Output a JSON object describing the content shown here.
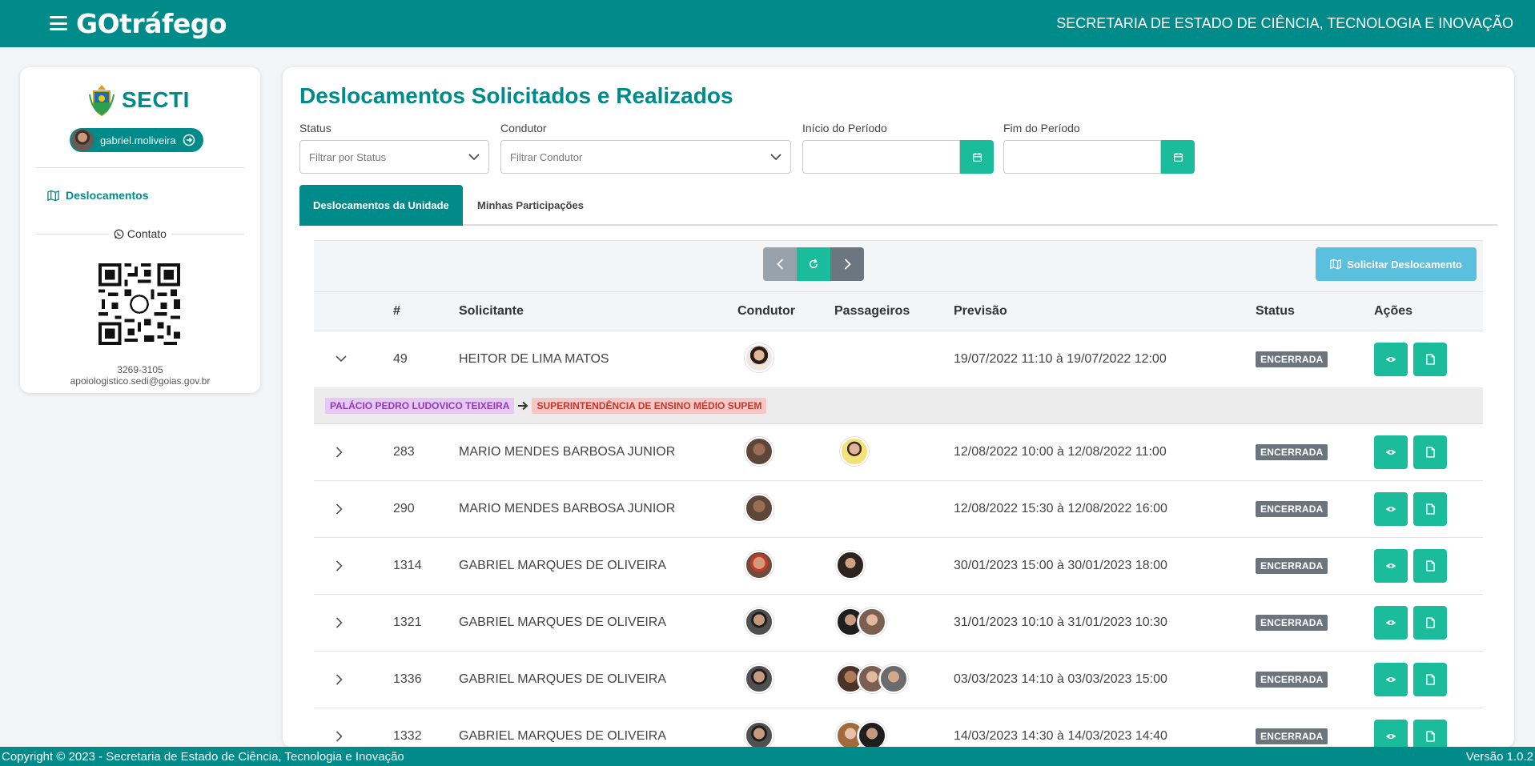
{
  "app": {
    "brand": "GOtráfego",
    "org": "SECRETARIA DE ESTADO DE CIÊNCIA, TECNOLOGIA E INOVAÇÃO"
  },
  "sidebar": {
    "logo": "SECTI",
    "user": "gabriel.moliveira",
    "nav": [
      {
        "label": "Deslocamentos",
        "icon": "map-icon"
      }
    ],
    "contact_label": "Contato",
    "phone": "3269-3105",
    "email": "apoiologistico.sedi@goias.gov.br"
  },
  "main": {
    "title": "Deslocamentos Solicitados e Realizados",
    "filters": {
      "status_label": "Status",
      "status_placeholder": "Filtrar por Status",
      "driver_label": "Condutor",
      "driver_placeholder": "Filtrar Condutor",
      "start_label": "Início do Período",
      "end_label": "Fim do Período"
    },
    "tabs": [
      "Deslocamentos da Unidade",
      "Minhas Participações"
    ],
    "request_button": "Solicitar Deslocamento",
    "columns": [
      "#",
      "Solicitante",
      "Condutor",
      "Passageiros",
      "Previsão",
      "Status",
      "Ações"
    ],
    "route": {
      "origin": "PALÁCIO PEDRO LUDOVICO TEIXEIRA",
      "destination": "SUPERINTENDÊNCIA DE ENSINO MÉDIO SUPEM"
    },
    "rows": [
      {
        "id": "49",
        "requester": "HEITOR DE LIMA MATOS",
        "forecast": "19/07/2022 11:10 à 19/07/2022 12:00",
        "status": "ENCERRADA"
      },
      {
        "id": "283",
        "requester": "MARIO MENDES BARBOSA JUNIOR",
        "forecast": "12/08/2022 10:00 à 12/08/2022 11:00",
        "status": "ENCERRADA"
      },
      {
        "id": "290",
        "requester": "MARIO MENDES BARBOSA JUNIOR",
        "forecast": "12/08/2022 15:30 à 12/08/2022 16:00",
        "status": "ENCERRADA"
      },
      {
        "id": "1314",
        "requester": "GABRIEL MARQUES DE OLIVEIRA",
        "forecast": "30/01/2023 15:00 à 30/01/2023 18:00",
        "status": "ENCERRADA"
      },
      {
        "id": "1321",
        "requester": "GABRIEL MARQUES DE OLIVEIRA",
        "forecast": "31/01/2023 10:10 à 31/01/2023 10:30",
        "status": "ENCERRADA"
      },
      {
        "id": "1336",
        "requester": "GABRIEL MARQUES DE OLIVEIRA",
        "forecast": "03/03/2023 14:10 à 03/03/2023 15:00",
        "status": "ENCERRADA"
      },
      {
        "id": "1332",
        "requester": "GABRIEL MARQUES DE OLIVEIRA",
        "forecast": "14/03/2023 14:30 à 14/03/2023 14:40",
        "status": "ENCERRADA"
      }
    ]
  },
  "footer": {
    "copyright": "Copyright © 2023 - Secretaria de Estado de Ciência, Tecnologia e Inovação",
    "version": "Versão 1.0.2"
  },
  "colors": {
    "primary": "#008b8b",
    "accent": "#1abc9c",
    "info": "#5bc0de",
    "status_closed": "#6c757d"
  }
}
